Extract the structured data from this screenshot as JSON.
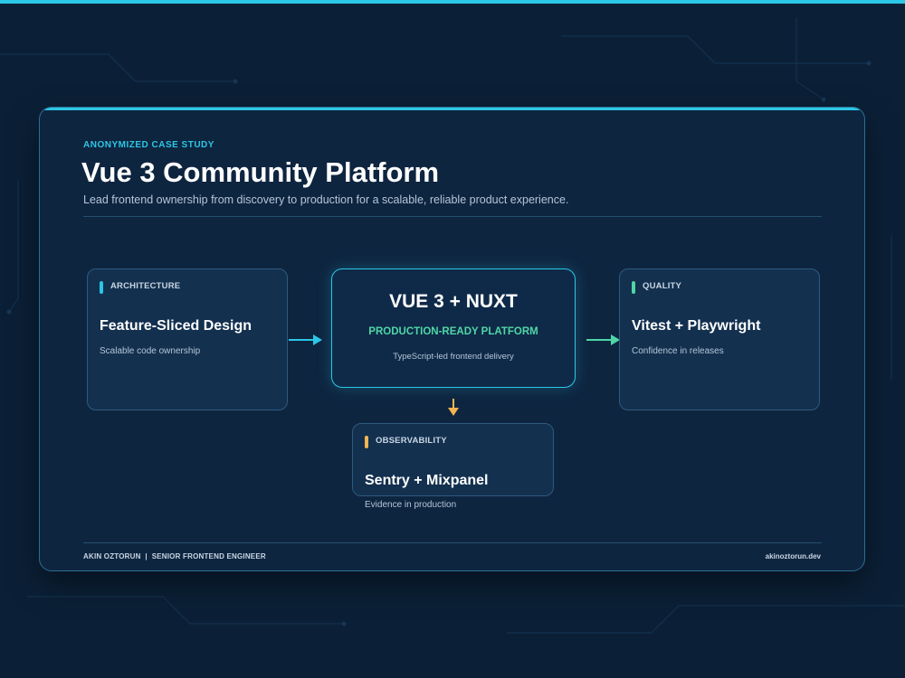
{
  "eyebrow": "ANONYMIZED CASE STUDY",
  "title": "Vue 3 Community Platform",
  "subtitle": "Lead frontend ownership from discovery to production for a scalable, reliable product experience.",
  "center": {
    "title": "VUE 3 + NUXT",
    "subtitle": "PRODUCTION-READY PLATFORM",
    "description": "TypeScript-led frontend delivery"
  },
  "architecture": {
    "label": "ARCHITECTURE",
    "heading": "Feature-Sliced Design",
    "description": "Scalable code ownership",
    "accent": "#2cc6e6"
  },
  "quality": {
    "label": "QUALITY",
    "heading": "Vitest + Playwright",
    "description": "Confidence in releases",
    "accent": "#4fd6a6"
  },
  "observability": {
    "label": "OBSERVABILITY",
    "heading": "Sentry + Mixpanel",
    "description": "Evidence in production",
    "accent": "#f2b552"
  },
  "footer": {
    "author": "AKIN OZTORUN  |  SENIOR FRONTEND ENGINEER",
    "site": "akinoztorun.dev"
  },
  "colors": {
    "background": "#0b2037",
    "card": "#0e2540",
    "primary_accent": "#2cc6e6",
    "quality_accent": "#4fd6a6",
    "observability_accent": "#f2b552"
  }
}
